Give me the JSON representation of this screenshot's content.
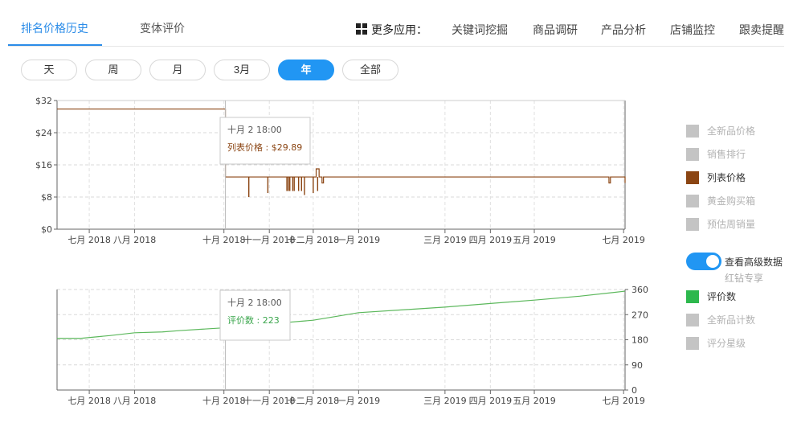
{
  "tabs": [
    {
      "label": "排名价格历史",
      "active": true
    },
    {
      "label": "变体评价",
      "active": false
    }
  ],
  "more_apps_label": "更多应用：",
  "menu": [
    "关键词挖掘",
    "商品调研",
    "产品分析",
    "店铺监控",
    "跟卖提醒"
  ],
  "ranges": [
    {
      "label": "天",
      "active": false
    },
    {
      "label": "周",
      "active": false
    },
    {
      "label": "月",
      "active": false
    },
    {
      "label": "3月",
      "active": false
    },
    {
      "label": "年",
      "active": true
    },
    {
      "label": "全部",
      "active": false
    }
  ],
  "legend_top": [
    {
      "label": "全新品价格",
      "color": "#c4c4c4",
      "enabled": false
    },
    {
      "label": "销售排行",
      "color": "#c4c4c4",
      "enabled": false
    },
    {
      "label": "列表价格",
      "color": "#8b4513",
      "enabled": true
    },
    {
      "label": "黄金购买箱",
      "color": "#c4c4c4",
      "enabled": false
    },
    {
      "label": "预估周销量",
      "color": "#c4c4c4",
      "enabled": false
    }
  ],
  "advanced_toggle": {
    "label": "查看高级数据",
    "sublabel": "红钻专享",
    "on": true
  },
  "legend_bottom": [
    {
      "label": "评价数",
      "color": "#2db84d",
      "enabled": true
    },
    {
      "label": "全新品计数",
      "color": "#c4c4c4",
      "enabled": false
    },
    {
      "label": "评分星级",
      "color": "#c4c4c4",
      "enabled": false
    }
  ],
  "colors": {
    "accent": "#2196f3",
    "price_line": "#8b4513",
    "reviews_line": "#5cb85c",
    "tooltip_price_text": "#8b4513",
    "tooltip_reviews_text": "#3aa64c"
  },
  "chart_data": [
    {
      "type": "line",
      "x_tick_labels": [
        "七月 2018",
        "八月 2018",
        "十月 2018",
        "十一月 2018",
        "十二月 2018",
        "一月 2019",
        "三月 2019",
        "四月 2019",
        "五月 2019",
        "七月 2019"
      ],
      "x_tick_dates": [
        "2018-07-01",
        "2018-08-01",
        "2018-10-01",
        "2018-11-01",
        "2018-12-01",
        "2019-01-01",
        "2019-03-01",
        "2019-04-01",
        "2019-05-01",
        "2019-07-01"
      ],
      "xlim": [
        "2018-06-09",
        "2019-07-02"
      ],
      "ylim": [
        0,
        32
      ],
      "y_ticks": [
        0,
        8,
        16,
        24,
        32
      ],
      "y_tick_labels": [
        "$0",
        "$8",
        "$16",
        "$24",
        "$32"
      ],
      "grid": true,
      "series": [
        {
          "name": "列表价格",
          "points": [
            {
              "x": "2018-06-09",
              "y": 29.89
            },
            {
              "x": "2018-10-01",
              "y": 29.89
            },
            {
              "x": "2018-10-02",
              "y": 12.99
            },
            {
              "x": "2018-12-01",
              "y": 12.99
            },
            {
              "x": "2018-12-03",
              "y": 15.0
            },
            {
              "x": "2018-12-05",
              "y": 12.99
            },
            {
              "x": "2018-12-07",
              "y": 11.5
            },
            {
              "x": "2018-12-08",
              "y": 12.99
            },
            {
              "x": "2019-06-20",
              "y": 12.99
            },
            {
              "x": "2019-06-21",
              "y": 11.5
            },
            {
              "x": "2019-06-22",
              "y": 12.99
            },
            {
              "x": "2019-07-01",
              "y": 12.99
            },
            {
              "x": "2019-07-02",
              "y": 11.5
            }
          ],
          "dips": [
            {
              "x": "2018-10-18",
              "y": 8.0
            },
            {
              "x": "2018-10-31",
              "y": 9.0
            },
            {
              "x": "2018-11-13",
              "y": 9.5
            },
            {
              "x": "2018-11-14",
              "y": 9.5
            },
            {
              "x": "2018-11-15",
              "y": 9.5
            },
            {
              "x": "2018-11-17",
              "y": 9.5
            },
            {
              "x": "2018-11-18",
              "y": 9.5
            },
            {
              "x": "2018-11-21",
              "y": 9.5
            },
            {
              "x": "2018-11-23",
              "y": 9.5
            },
            {
              "x": "2018-11-25",
              "y": 8.5
            },
            {
              "x": "2018-12-01",
              "y": 9.0
            },
            {
              "x": "2018-12-04",
              "y": 9.5
            }
          ]
        }
      ],
      "tooltip": {
        "date": "十月 2 18:00",
        "label": "列表价格 : $29.89"
      }
    },
    {
      "type": "line",
      "x_tick_labels": [
        "七月 2018",
        "八月 2018",
        "十月 2018",
        "十一月 2018",
        "十二月 2018",
        "一月 2019",
        "三月 2019",
        "四月 2019",
        "五月 2019",
        "七月 2019"
      ],
      "x_tick_dates": [
        "2018-07-01",
        "2018-08-01",
        "2018-10-01",
        "2018-11-01",
        "2018-12-01",
        "2019-01-01",
        "2019-03-01",
        "2019-04-01",
        "2019-05-01",
        "2019-07-01"
      ],
      "xlim": [
        "2018-06-09",
        "2019-07-02"
      ],
      "ylim": [
        0,
        360
      ],
      "y_ticks": [
        0,
        90,
        180,
        270,
        360
      ],
      "y_tick_labels": [
        "0",
        "90",
        "180",
        "270",
        "360"
      ],
      "grid": true,
      "series": [
        {
          "name": "评价数",
          "points": [
            {
              "x": "2018-06-09",
              "y": 185
            },
            {
              "x": "2018-06-25",
              "y": 185
            },
            {
              "x": "2018-07-15",
              "y": 195
            },
            {
              "x": "2018-08-01",
              "y": 205
            },
            {
              "x": "2018-08-20",
              "y": 208
            },
            {
              "x": "2018-09-01",
              "y": 213
            },
            {
              "x": "2018-10-02",
              "y": 223
            },
            {
              "x": "2018-11-01",
              "y": 237
            },
            {
              "x": "2018-12-01",
              "y": 250
            },
            {
              "x": "2019-01-01",
              "y": 277
            },
            {
              "x": "2019-03-01",
              "y": 297
            },
            {
              "x": "2019-04-01",
              "y": 310
            },
            {
              "x": "2019-05-01",
              "y": 322
            },
            {
              "x": "2019-06-01",
              "y": 336
            },
            {
              "x": "2019-07-02",
              "y": 354
            }
          ]
        }
      ],
      "tooltip": {
        "date": "十月 2 18:00",
        "label": "评价数 : 223"
      }
    }
  ]
}
